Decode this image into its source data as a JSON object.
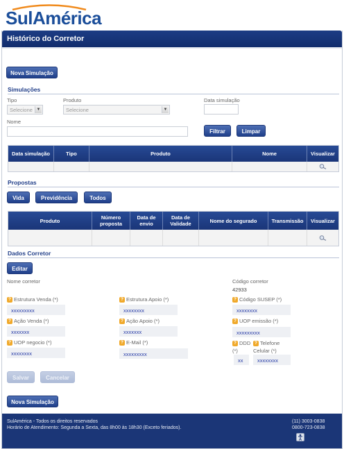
{
  "brand": {
    "name": "SulAmérica",
    "primary_color": "#1b4e9a",
    "accent_color": "#f0a92a"
  },
  "page": {
    "title": "Histórico do Corretor"
  },
  "buttons": {
    "nova_simulacao": "Nova Simulação",
    "filtrar": "Filtrar",
    "limpar": "Limpar",
    "vida": "Vida",
    "previdencia": "Previdência",
    "todos": "Todos",
    "editar": "Editar",
    "salvar": "Salvar",
    "cancelar": "Cancelar"
  },
  "simulacoes": {
    "heading": "Simulações",
    "tipo_label": "Tipo",
    "tipo_value": "Selecione",
    "produto_label": "Produto",
    "produto_value": "Selecione",
    "data_label": "Data simulação",
    "data_value": "",
    "nome_label": "Nome",
    "nome_value": "",
    "columns": [
      "Data simulação",
      "Tipo",
      "Produto",
      "Nome",
      "Visualizar"
    ]
  },
  "propostas": {
    "heading": "Propostas",
    "columns": [
      "Produto",
      "Número proposta",
      "Data de envio",
      "Data de Validade",
      "Nome do segurado",
      "Transmissão",
      "Visualizar"
    ]
  },
  "corretor": {
    "heading": "Dados Corretor",
    "nome_label": "Nome corretor",
    "codigo_label": "Código corretor",
    "codigo_value": "42933",
    "fields": {
      "estrutura_venda": {
        "label": "Estrutura Venda (*)",
        "value": "xxxxxxxxx"
      },
      "acao_venda": {
        "label": "Ação Venda (*)",
        "value": "xxxxxxx"
      },
      "uop_negocio": {
        "label": "UOP negocio (*)",
        "value": "xxxxxxxx"
      },
      "estrutura_apoio": {
        "label": "Estrutura Apoio (*)",
        "value": "xxxxxxxx"
      },
      "acao_apoio": {
        "label": "Ação Apoio (*)",
        "value": "xxxxxxx"
      },
      "email": {
        "label": "E-Mail (*)",
        "value": "xxxxxxxxx"
      },
      "codigo_susep": {
        "label": "Código SUSEP (*)",
        "value": "xxxxxxxx"
      },
      "uop_emissao": {
        "label": "UOP emissão (*)",
        "value": "xxxxxxxxx"
      },
      "ddd": {
        "label": "DDD",
        "label2": "(*)",
        "value": "xx"
      },
      "telefone": {
        "label": "Telefone",
        "label2": "Celular (*)",
        "value": "xxxxxxxx"
      }
    }
  },
  "footer": {
    "rights": "SulAmérica - Todos os direitos reservados",
    "hours": "Horário de Atendimento: Segunda a Sexta, das 8h00 às 18h30 (Exceto feriados).",
    "phone1": "(11) 3003-0838",
    "phone2": "0800-723-0838"
  },
  "icons": {
    "magnifier": "magnifier-icon",
    "help": "help-icon",
    "accessibility": "accessibility-icon"
  }
}
